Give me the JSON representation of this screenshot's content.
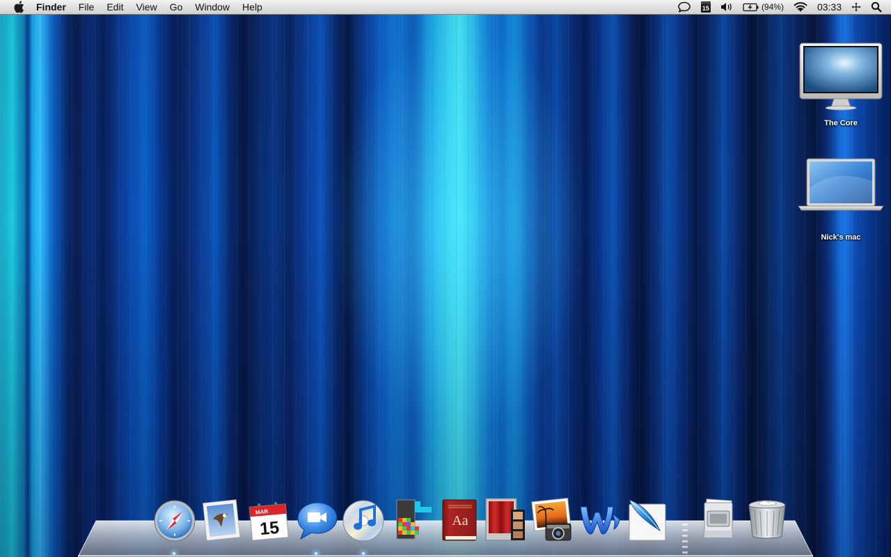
{
  "menubar": {
    "app_name": "Finder",
    "menus": [
      "File",
      "Edit",
      "View",
      "Go",
      "Window",
      "Help"
    ],
    "status": {
      "chat_icon": "speech-bubble-icon",
      "calendar_day": "15",
      "volume_icon": "speaker-icon",
      "battery_percent": "(94%)",
      "wifi_icon": "wifi-icon",
      "clock": "03:33",
      "spaces_icon": "spaces-icon",
      "spotlight_icon": "magnifier-icon"
    }
  },
  "desktop": {
    "icons": [
      {
        "label": "The Core",
        "icon": "imac-display-icon"
      },
      {
        "label": "Nick's mac",
        "icon": "macbook-icon"
      }
    ]
  },
  "dock": {
    "apps": [
      {
        "icon": "safari-compass-icon",
        "running": true
      },
      {
        "icon": "mail-eagle-stamp-icon",
        "running": false
      },
      {
        "icon": "ical-calendar-icon",
        "month": "MAR",
        "day": "15",
        "running": false
      },
      {
        "icon": "ichat-video-icon",
        "running": true
      },
      {
        "icon": "itunes-cd-icon",
        "running": true
      },
      {
        "icon": "tetris-blocks-icon",
        "running": false
      },
      {
        "icon": "dictionary-book-icon",
        "book_text": "Aa",
        "running": false
      },
      {
        "icon": "photo-booth-icon",
        "running": false
      },
      {
        "icon": "iphoto-icon",
        "running": false
      },
      {
        "icon": "word-w-icon",
        "running": false
      },
      {
        "icon": "photoshop-feather-icon",
        "running": false
      }
    ],
    "others": [
      {
        "icon": "documents-stack-icon"
      },
      {
        "icon": "trash-can-icon"
      }
    ],
    "colors": {
      "accent": "#1e78e8",
      "glow": "#bfe6ff"
    }
  }
}
